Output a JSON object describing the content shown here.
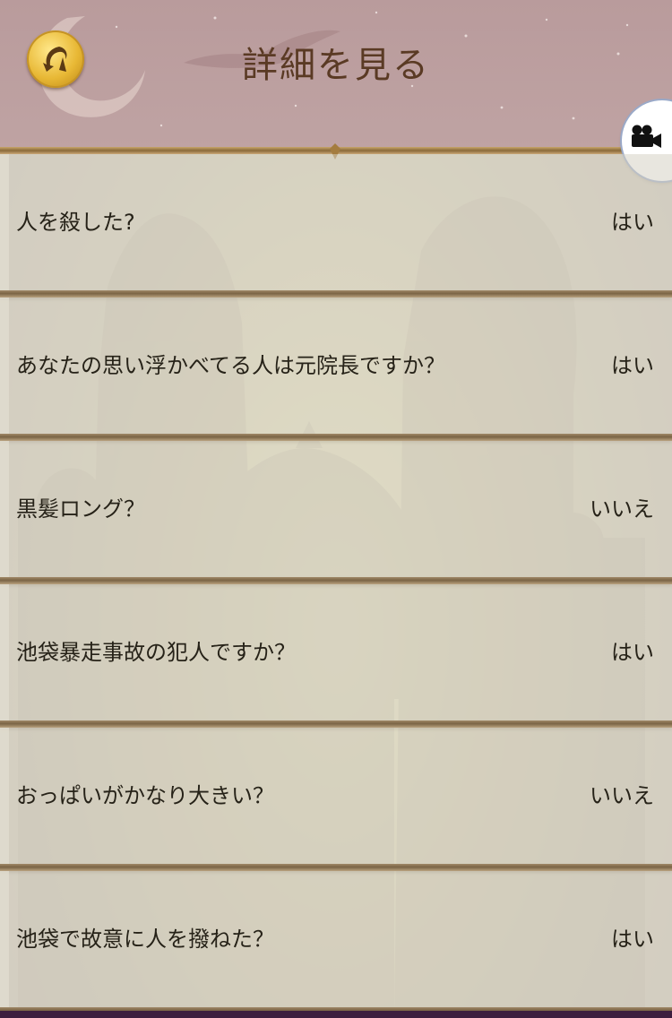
{
  "header": {
    "title": "詳細を見る",
    "back_icon": "back-arrow-icon",
    "camera_icon": "video-camera-icon"
  },
  "colors": {
    "header_bg": "#bfa3a3",
    "title_text": "#5a3a24",
    "coin_gold": "#e8b835",
    "row_text": "#262218"
  },
  "qa_list": [
    {
      "question": "人を殺した?",
      "answer": "はい"
    },
    {
      "question": "あなたの思い浮かべてる人は元院長ですか？",
      "answer": "はい"
    },
    {
      "question": "黒髪ロング？",
      "answer": "いいえ"
    },
    {
      "question": "池袋暴走事故の犯人ですか？",
      "answer": "はい"
    },
    {
      "question": "おっぱいがかなり大きい？",
      "answer": "いいえ"
    },
    {
      "question": "池袋で故意に人を撥ねた？",
      "answer": "はい"
    }
  ]
}
